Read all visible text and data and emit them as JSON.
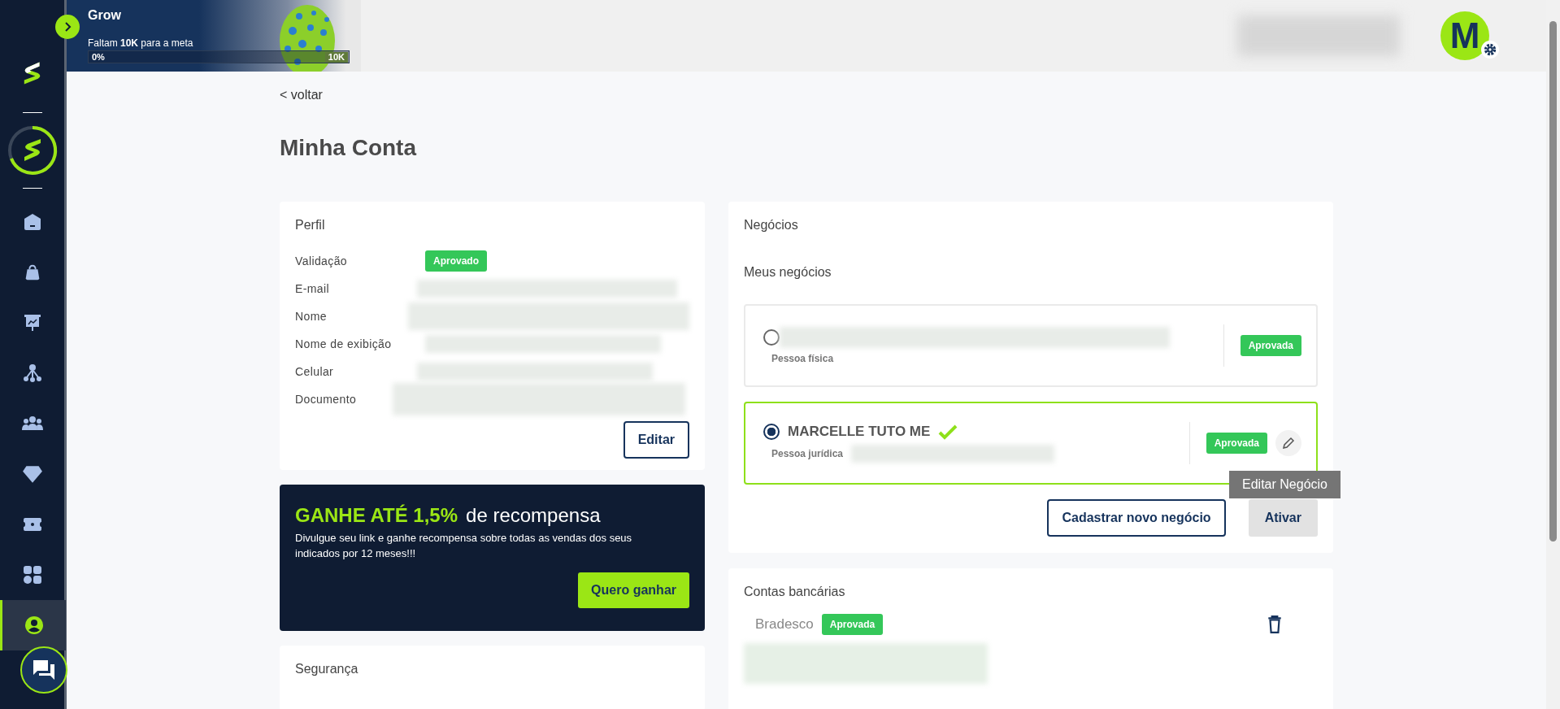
{
  "grow": {
    "title": "Grow",
    "goal": "Faltam **10K** para a meta",
    "progress_start": "0%",
    "progress_end": "10K",
    "level": 0
  },
  "avatar": {
    "initial": "M"
  },
  "sidebar": {
    "items": [
      {
        "kind": "home",
        "selected": false
      },
      {
        "kind": "bag",
        "selected": false
      },
      {
        "kind": "board",
        "selected": false
      },
      {
        "kind": "network",
        "selected": false
      },
      {
        "kind": "people",
        "selected": false
      },
      {
        "kind": "diamond",
        "selected": false
      },
      {
        "kind": "ticket",
        "selected": false
      },
      {
        "kind": "grid",
        "selected": false
      },
      {
        "kind": "profile",
        "selected": true
      }
    ]
  },
  "back_link": "< voltar",
  "title": "Minha Conta",
  "profile": {
    "title": "Perfil",
    "fields": [
      {
        "label": "Validação",
        "kind": "badge",
        "badge": "Aprovado"
      },
      {
        "label": "E-mail",
        "kind": "hidden"
      },
      {
        "label": "Nome",
        "kind": "hidden"
      },
      {
        "label": "Nome de exibição",
        "kind": "hidden"
      },
      {
        "label": "Celular",
        "kind": "hidden"
      },
      {
        "label": "Documento",
        "kind": "hidden"
      }
    ],
    "edit_button": "Editar"
  },
  "promo": {
    "headline_highlight": "GANHE ATÉ 1,5%",
    "headline_rest": "de recompensa",
    "text": "Divulgue seu link e ganhe recompensa sobre todas as vendas dos seus indicados por 12 meses!!!",
    "button": "Quero ganhar"
  },
  "security": {
    "title": "Segurança"
  },
  "business": {
    "title": "Negócios",
    "subtitle": "Meus negócios",
    "items": [
      {
        "name_hidden": true,
        "document_hidden": false,
        "type_label": "Pessoa física",
        "status": "Aprovada",
        "selected": false,
        "verified": false,
        "editable": false
      },
      {
        "name_hidden": false,
        "document_hidden": true,
        "name": "MARCELLE TUTO ME",
        "type_label": "Pessoa jurídica",
        "status": "Aprovada",
        "selected": true,
        "verified": true,
        "editable": true
      }
    ],
    "tooltip": "Editar Negócio",
    "new_button": "Cadastrar novo negócio",
    "activate_button": "Ativar"
  },
  "bank": {
    "title": "Contas bancárias",
    "accounts": [
      {
        "bank": "Bradesco",
        "status": "Aprovada"
      }
    ]
  }
}
